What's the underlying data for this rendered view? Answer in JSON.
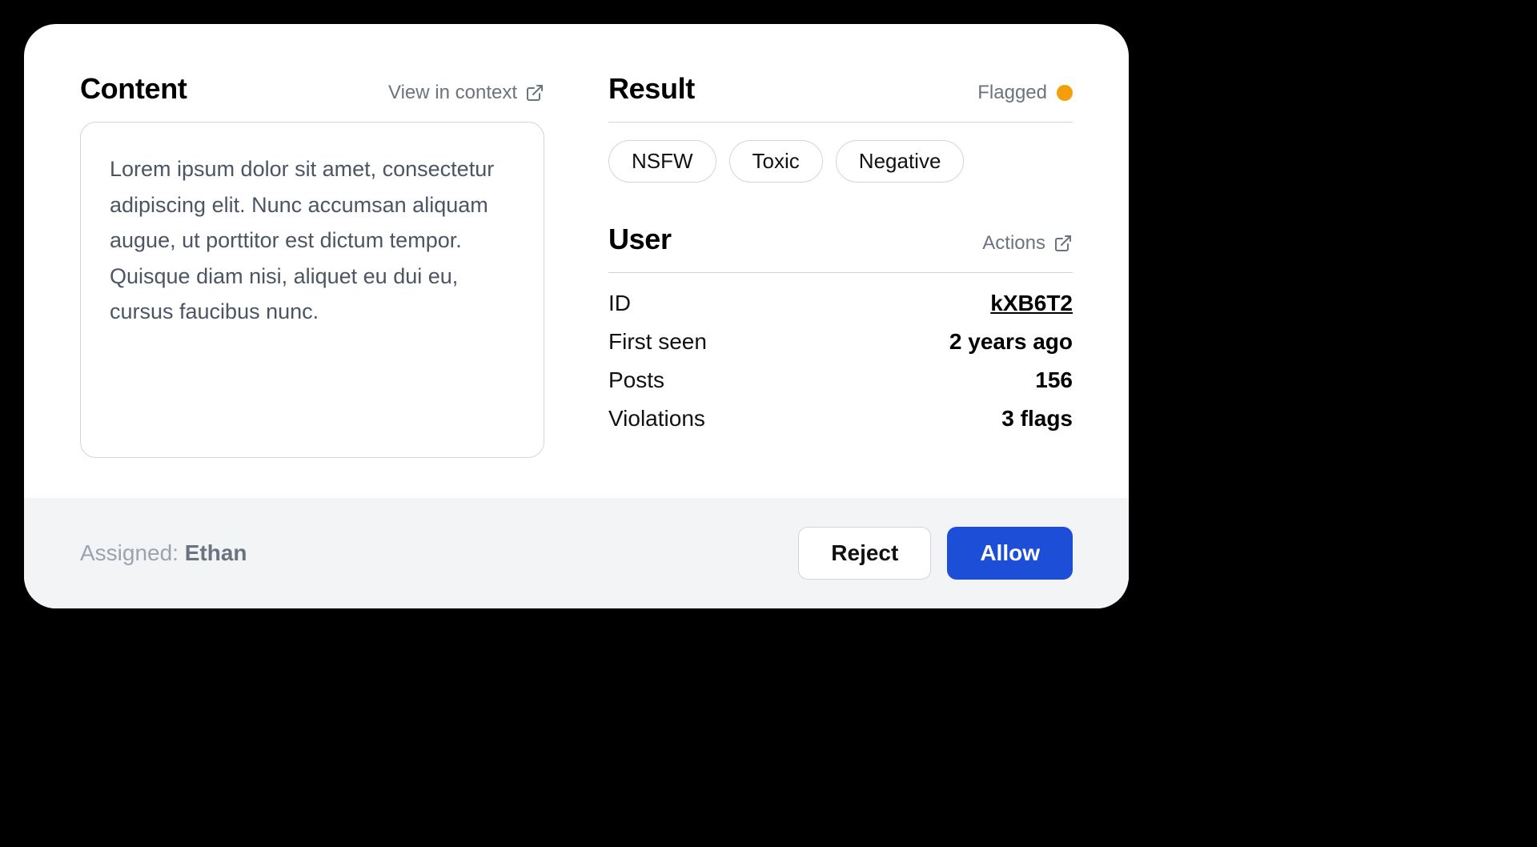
{
  "content": {
    "title": "Content",
    "view_in_context": "View in context",
    "body": "Lorem ipsum dolor sit amet, consectetur adipiscing elit. Nunc accumsan aliquam augue, ut porttitor est dictum tempor. Quisque diam nisi, aliquet eu dui eu, cursus faucibus nunc."
  },
  "result": {
    "title": "Result",
    "status_label": "Flagged",
    "status_color": "#f59e0b",
    "tags": [
      "NSFW",
      "Toxic",
      "Negative"
    ]
  },
  "user": {
    "title": "User",
    "actions_label": "Actions",
    "rows": [
      {
        "label": "ID",
        "value": "kXB6T2",
        "link": true
      },
      {
        "label": "First seen",
        "value": "2 years ago",
        "link": false
      },
      {
        "label": "Posts",
        "value": "156",
        "link": false
      },
      {
        "label": "Violations",
        "value": "3 flags",
        "link": false
      }
    ]
  },
  "footer": {
    "assigned_label": "Assigned: ",
    "assigned_name": "Ethan",
    "reject": "Reject",
    "allow": "Allow"
  }
}
